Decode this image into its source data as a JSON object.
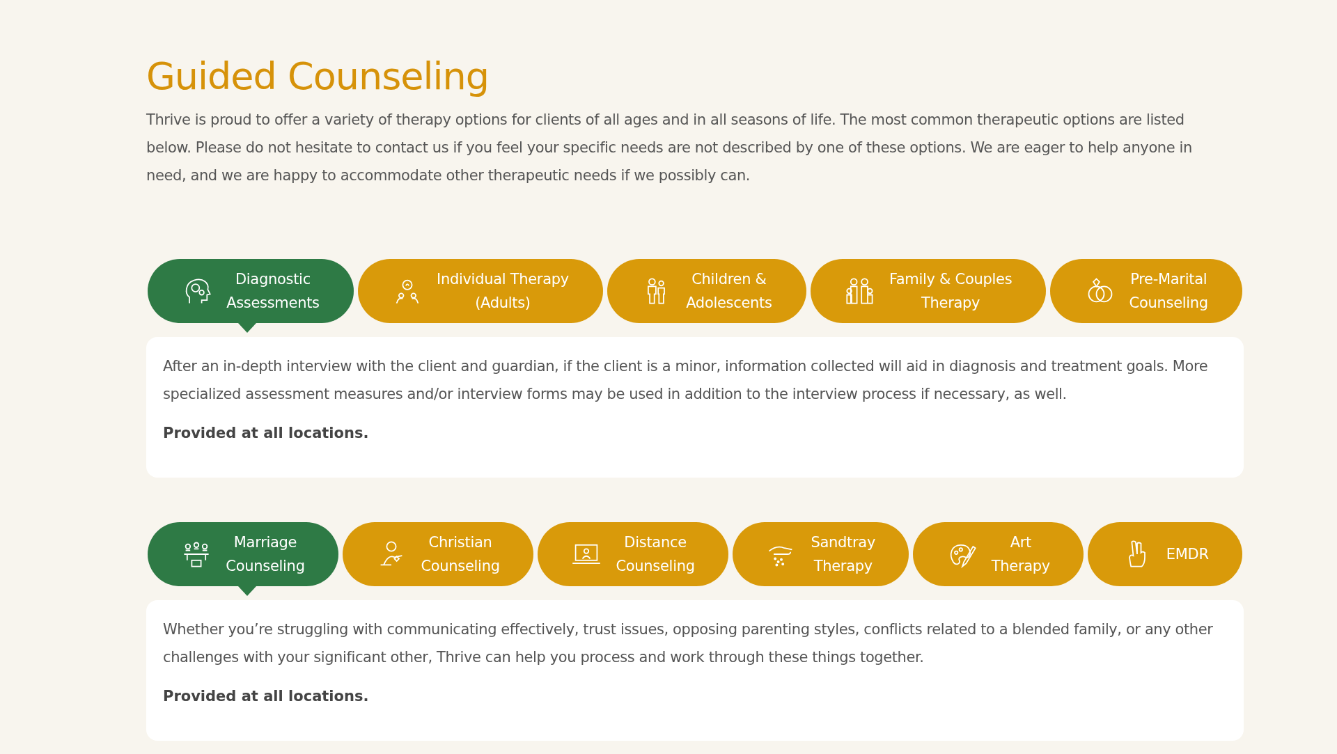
{
  "title": "Guided Counseling",
  "intro": "Thrive is proud to offer a variety of therapy options for clients of all ages and in all seasons of life. The most common therapeutic options are listed below. Please do not hesitate to contact us if you feel your specific needs are not described by one of these options. We are eager to help anyone in need, and we are happy to accommodate other therapeutic needs if we possibly can.",
  "sections": [
    {
      "tabs": [
        {
          "label": "Diagnostic\nAssessments",
          "selected": true
        },
        {
          "label": "Individual Therapy\n(Adults)",
          "selected": false
        },
        {
          "label": "Children &\nAdolescents",
          "selected": false
        },
        {
          "label": "Family & Couples\nTherapy",
          "selected": false
        },
        {
          "label": "Pre-Marital\nCounseling",
          "selected": false
        }
      ],
      "panel": {
        "description": "After an in-depth interview with the client and guardian, if the client is a minor, information collected will aid in diagnosis and treatment goals. More specialized assessment measures and/or interview forms may be used in addition to the interview process if necessary, as well.",
        "note": "Provided at all locations."
      }
    },
    {
      "tabs": [
        {
          "label": "Marriage\nCounseling",
          "selected": true
        },
        {
          "label": "Christian\nCounseling",
          "selected": false
        },
        {
          "label": "Distance\nCounseling",
          "selected": false
        },
        {
          "label": "Sandtray\nTherapy",
          "selected": false
        },
        {
          "label": "Art\nTherapy",
          "selected": false
        },
        {
          "label": "EMDR",
          "selected": false
        }
      ],
      "panel": {
        "description": "Whether you’re struggling with communicating effectively, trust issues, opposing parenting styles, conflicts related to a blended family, or any other challenges with your significant other, Thrive can help you process and work through these things together.",
        "note": "Provided at all locations."
      }
    }
  ]
}
